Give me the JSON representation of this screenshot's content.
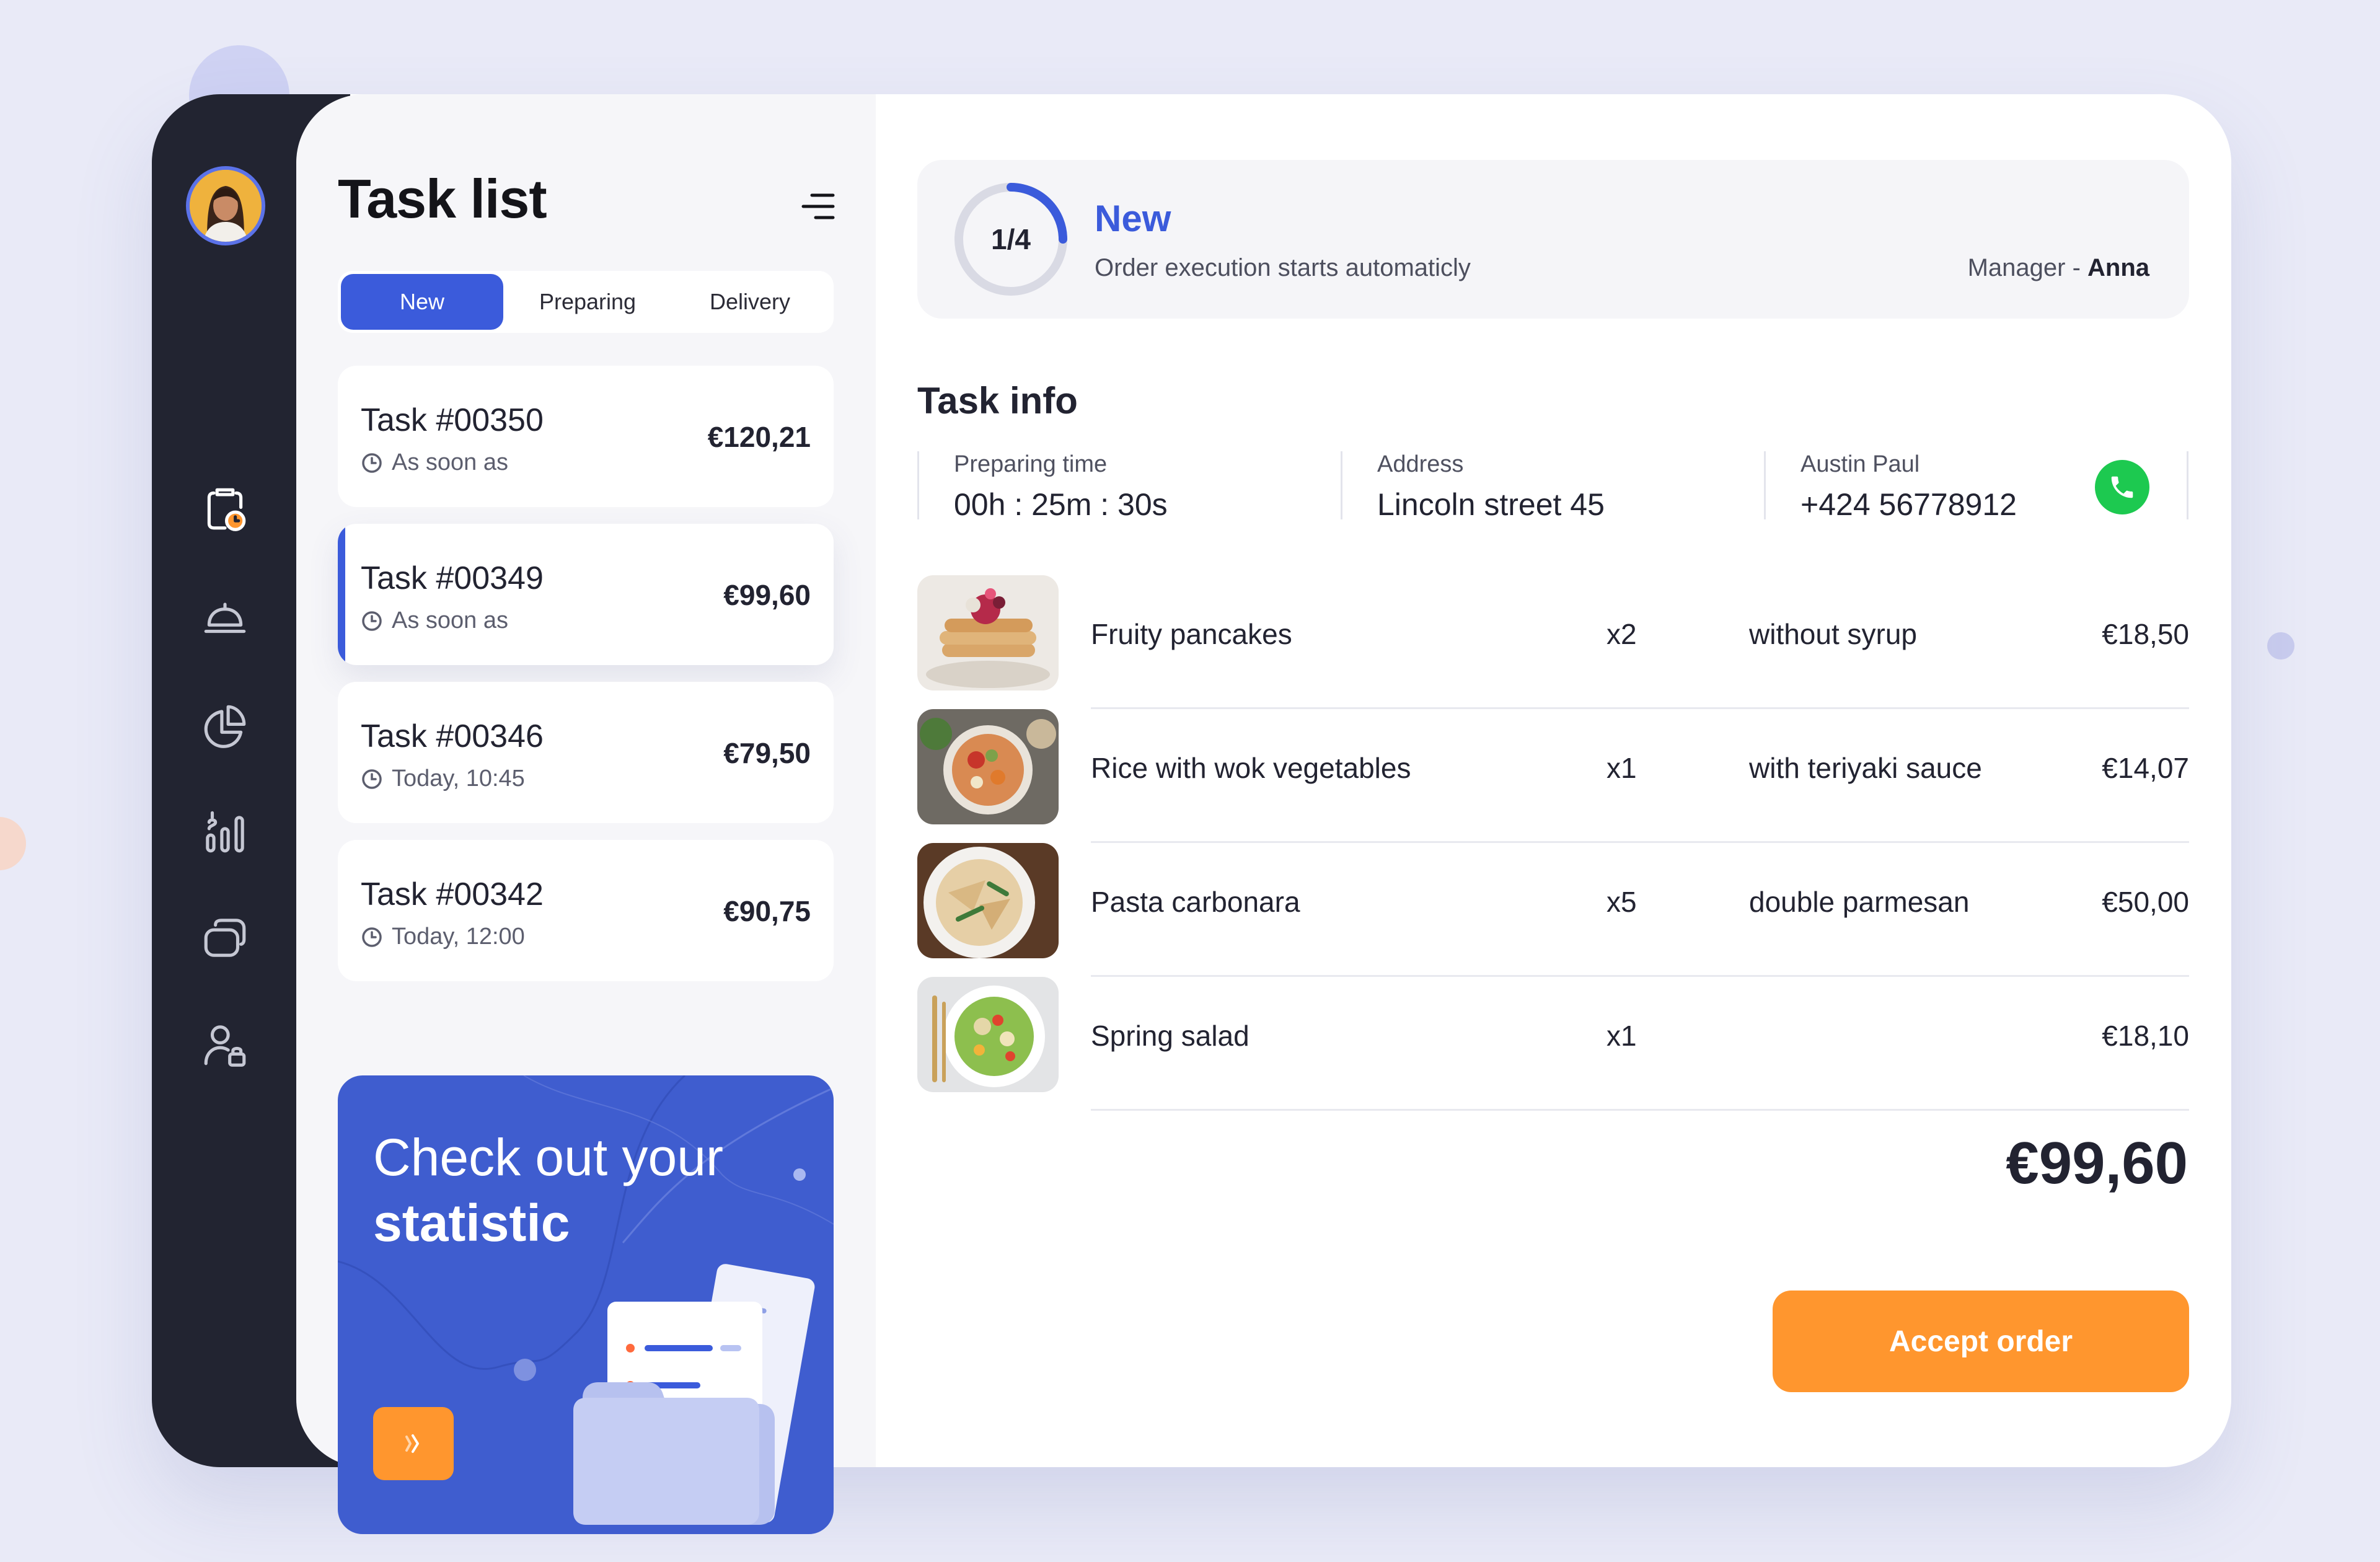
{
  "colors": {
    "accent": "#3B5BDB",
    "orange": "#FF962E",
    "sidebar": "#222431",
    "call_green": "#1DC950"
  },
  "sidebar": {
    "icons": [
      "orders-clock-icon",
      "cloche-icon",
      "pie-chart-icon",
      "finance-bars-icon",
      "cards-icon",
      "user-lock-icon"
    ]
  },
  "task_list": {
    "title": "Task list",
    "tabs": [
      {
        "label": "New",
        "active": true
      },
      {
        "label": "Preparing",
        "active": false
      },
      {
        "label": "Delivery",
        "active": false
      }
    ],
    "tasks": [
      {
        "name": "Task #00350",
        "time": "As soon as",
        "price": "€120,21",
        "selected": false
      },
      {
        "name": "Task #00349",
        "time": "As soon as",
        "price": "€99,60",
        "selected": true
      },
      {
        "name": "Task #00346",
        "time": "Today, 10:45",
        "price": "€79,50",
        "selected": false
      },
      {
        "name": "Task #00342",
        "time": "Today, 12:00",
        "price": "€90,75",
        "selected": false
      }
    ]
  },
  "promo": {
    "line1": "Check out your",
    "line2": "statistic"
  },
  "status": {
    "progress_label": "1/4",
    "progress_fraction": 0.25,
    "title": "New",
    "subtitle": "Order execution starts automaticly",
    "manager_label": "Manager - ",
    "manager_name": "Anna"
  },
  "task_info": {
    "title": "Task info",
    "preparing_label": "Preparing time",
    "preparing_value": "00h : 25m : 30s",
    "address_label": "Address",
    "address_value": "Lincoln street 45",
    "contact_name": "Austin Paul",
    "contact_phone": "+424 56778912"
  },
  "items": [
    {
      "name": "Fruity pancakes",
      "qty": "x2",
      "note": "without syrup",
      "price": "€18,50"
    },
    {
      "name": "Rice with wok vegetables",
      "qty": "x1",
      "note": "with teriyaki sauce",
      "price": "€14,07"
    },
    {
      "name": "Pasta carbonara",
      "qty": "x5",
      "note": "double parmesan",
      "price": "€50,00"
    },
    {
      "name": "Spring salad",
      "qty": "x1",
      "note": "",
      "price": "€18,10"
    }
  ],
  "total": "€99,60",
  "accept_label": "Accept order"
}
